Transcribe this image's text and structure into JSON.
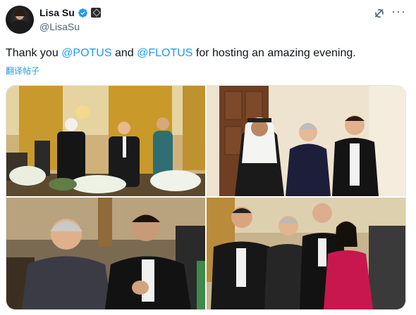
{
  "author": {
    "display_name": "Lisa Su",
    "handle": "@LisaSu"
  },
  "tweet": {
    "text_part1": "Thank you ",
    "mention1": "@POTUS",
    "text_part2": " and ",
    "mention2": "@FLOTUS",
    "text_part3": " for hosting an amazing evening.",
    "translate_label": "翻译帖子"
  },
  "colors": {
    "accent": "#1d9bf0",
    "verified": "#1d9bf0",
    "text": "#0f1419",
    "secondary": "#536471"
  },
  "icons": {
    "verified": "verified-badge-icon",
    "affiliation": "affiliation-badge-icon",
    "grok": "grok-icon",
    "more": "more-options-icon"
  }
}
